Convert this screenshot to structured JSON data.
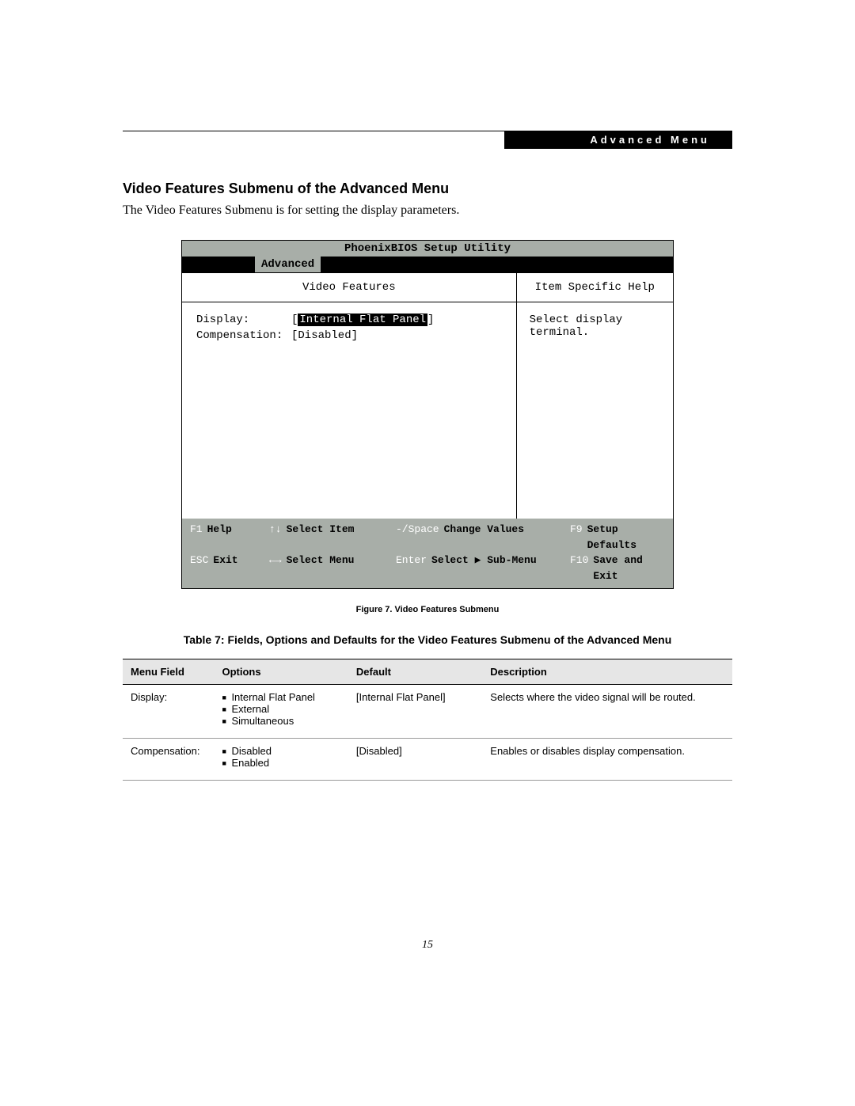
{
  "header": {
    "tab": "Advanced Menu"
  },
  "section": {
    "title": "Video Features Submenu of the Advanced Menu",
    "intro": "The Video Features Submenu is for setting the display parameters."
  },
  "bios": {
    "title": "PhoenixBIOS Setup Utility",
    "tab_active": "Advanced",
    "left_title": "Video Features",
    "right_title": "Item Specific Help",
    "help_text": "Select display terminal.",
    "fields": {
      "display_label": "Display:",
      "display_value": "Internal Flat Panel",
      "compensation_label": "Compensation:",
      "compensation_value": "[Disabled]"
    },
    "footer": {
      "f1_key": "F1",
      "f1_label": "Help",
      "esc_key": "ESC",
      "esc_label": "Exit",
      "updown_key": "↑↓",
      "updown_label": "Select Item",
      "lr_key": "←→",
      "lr_label": "Select Menu",
      "space_key": "-/Space",
      "space_label": "Change Values",
      "enter_key": "Enter",
      "enter_label": "Select ▶ Sub-Menu",
      "f9_key": "F9",
      "f9_label": "Setup Defaults",
      "f10_key": "F10",
      "f10_label": "Save and Exit"
    }
  },
  "figure_caption": "Figure 7.  Video Features Submenu",
  "table_caption": "Table 7: Fields, Options and Defaults for the Video Features Submenu of the Advanced Menu",
  "table": {
    "headers": {
      "menu": "Menu Field",
      "options": "Options",
      "default": "Default",
      "description": "Description"
    },
    "rows": [
      {
        "menu": "Display:",
        "options": [
          "Internal Flat Panel",
          "External",
          "Simultaneous"
        ],
        "default": "[Internal Flat Panel]",
        "description": "Selects where the video signal will be routed."
      },
      {
        "menu": "Compensation:",
        "options": [
          "Disabled",
          "Enabled"
        ],
        "default": "[Disabled]",
        "description": "Enables or disables display compensation."
      }
    ]
  },
  "page_number": "15"
}
